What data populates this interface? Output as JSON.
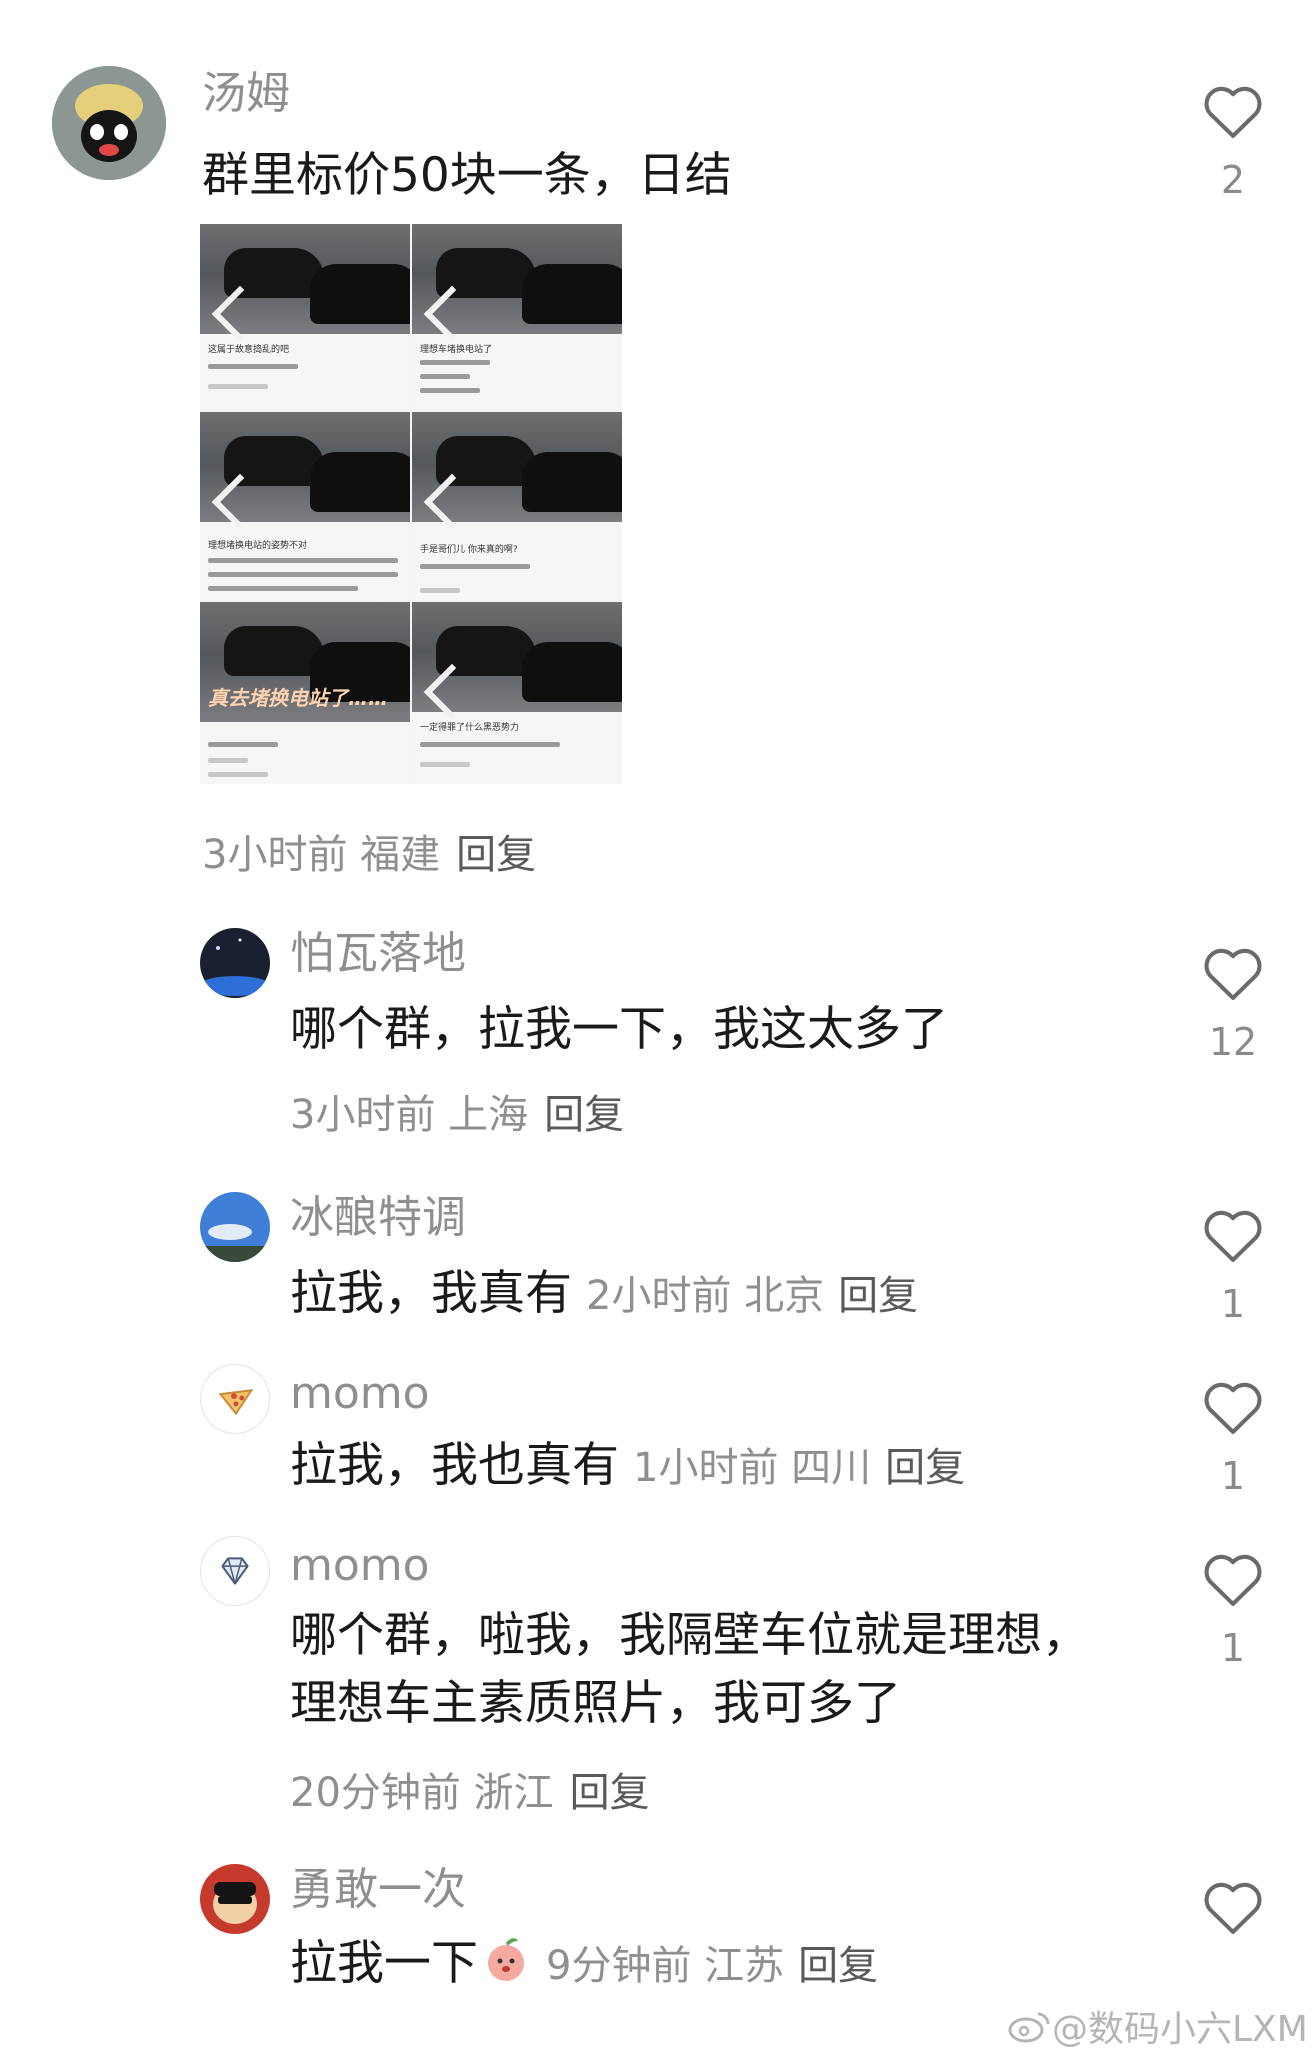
{
  "comments": [
    {
      "username": "汤姆",
      "text": "群里标价50块一条，日结",
      "meta": "3小时前 福建",
      "reply": "回复",
      "likes": "2",
      "image_captions": {
        "t1": "这属于故意捣乱的吧",
        "t2": "理想车堵换电站了",
        "t3": "理想堵换电站的姿势不对",
        "t4": "手是哥们儿 你来真的啊?",
        "t5": "真去堵换电站了……",
        "t6": "一定得罪了什么黑恶势力"
      }
    },
    {
      "username": "怕瓦落地",
      "text": "哪个群，拉我一下，我这太多了",
      "meta": "3小时前 上海",
      "reply": "回复",
      "likes": "12"
    },
    {
      "username": "冰酿特调",
      "text": "拉我，我真有",
      "meta": "2小时前 北京",
      "reply": "回复",
      "likes": "1"
    },
    {
      "username": "momo",
      "text": "拉我，我也真有",
      "meta": "1小时前 四川",
      "reply": "回复",
      "likes": "1"
    },
    {
      "username": "momo",
      "text_line1": "哪个群，啦我，我隔壁车位就是理想，",
      "text_line2": "理想车主素质照片，我可多了",
      "meta": "20分钟前 浙江",
      "reply": "回复",
      "likes": "1"
    },
    {
      "username": "勇敢一次",
      "text": "拉我一下",
      "meta": "9分钟前 江苏",
      "reply": "回复",
      "likes": ""
    }
  ],
  "watermark": "@数码小六LXM",
  "icons": {
    "like": "heart-outline-icon",
    "weibo": "weibo-logo-icon"
  }
}
